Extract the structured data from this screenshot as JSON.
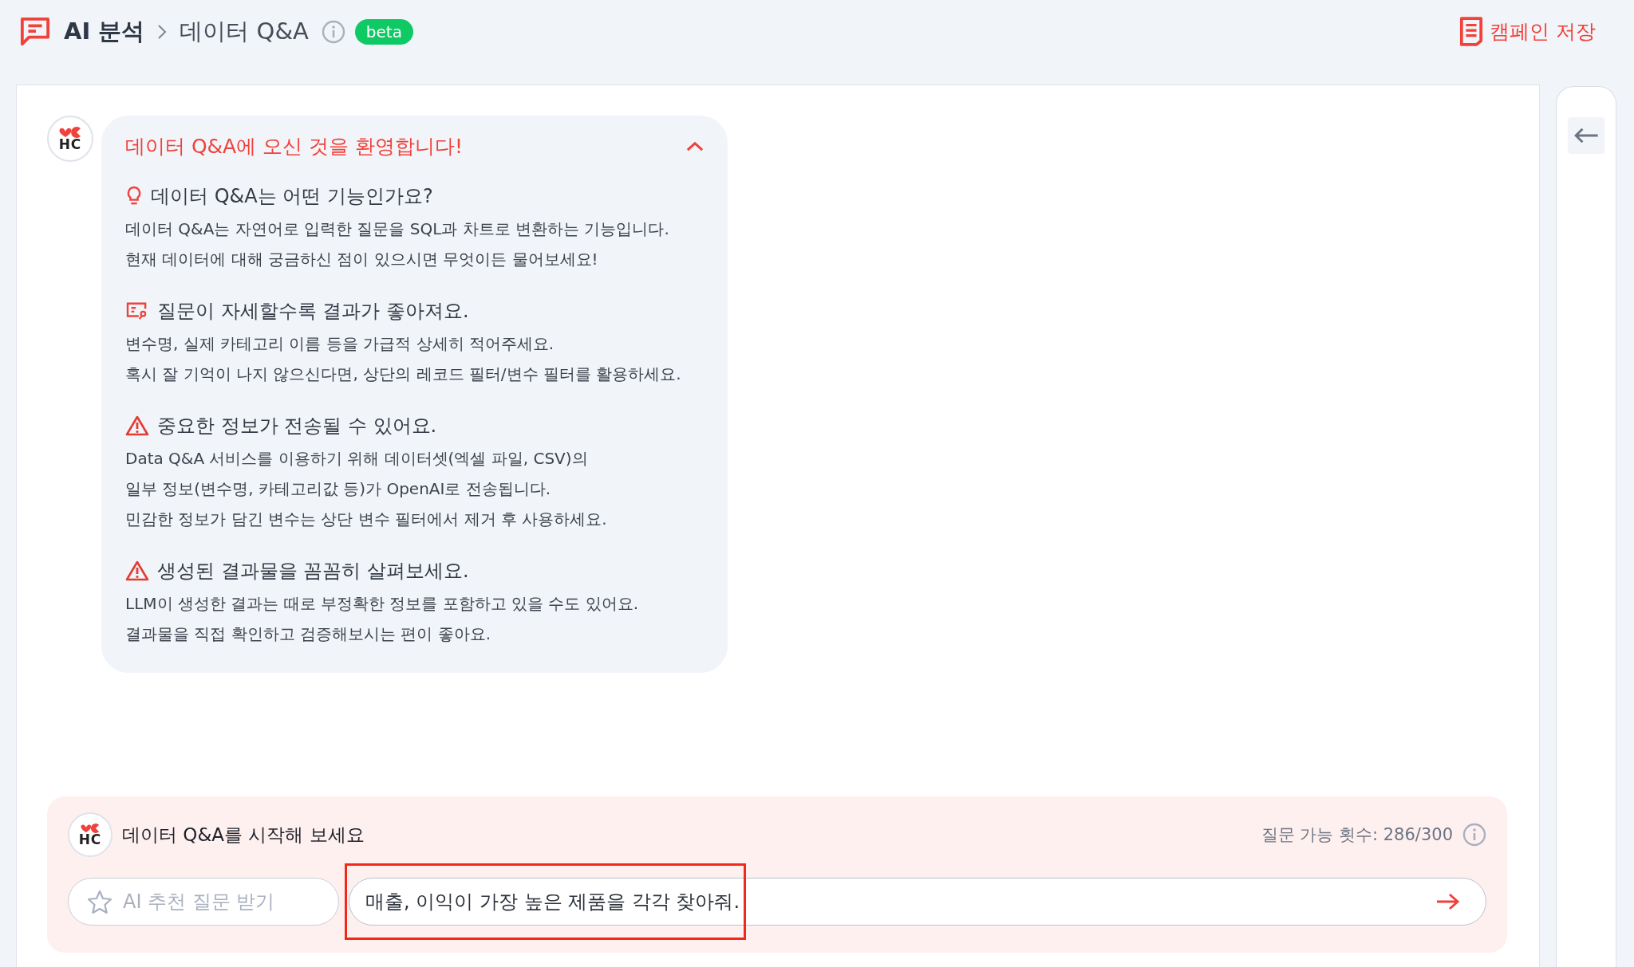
{
  "breadcrumb": [
    {
      "label": "AI 분석"
    },
    {
      "label": "데이터 Q&A"
    }
  ],
  "badge": "beta",
  "save_button": "캠페인 저장",
  "welcome": {
    "avatar": "HC",
    "title": "데이터 Q&A에 오신 것을 환영합니다!",
    "expanded": true,
    "sections": [
      {
        "kind": "bulb",
        "heading": "데이터 Q&A는 어떤 기능인가요?",
        "lines": [
          "데이터 Q&A는 자연어로 입력한 질문을 SQL과 차트로 변환하는 기능입니다.",
          "현재 데이터에 대해 궁금하신 점이 있으시면 무엇이든 물어보세요!"
        ]
      },
      {
        "kind": "filter",
        "heading": "질문이 자세할수록 결과가 좋아져요.",
        "lines": [
          "변수명, 실제 카테고리 이름 등을 가급적 상세히 적어주세요.",
          "혹시 잘 기억이 나지 않으신다면, 상단의 레코드 필터/변수 필터를 활용하세요."
        ]
      },
      {
        "kind": "warning",
        "heading": "중요한 정보가 전송될 수 있어요.",
        "lines": [
          "Data Q&A 서비스를 이용하기 위해 데이터셋(엑셀 파일, CSV)의",
          "일부 정보(변수명, 카테고리값 등)가 OpenAI로 전송됩니다.",
          "민감한 정보가 담긴 변수는 상단 변수 필터에서 제거 후 사용하세요."
        ]
      },
      {
        "kind": "warning",
        "heading": "생성된 결과물을 꼼꼼히 살펴보세요.",
        "lines": [
          "LLM이 생성한 결과는 때로 부정확한 정보를 포함하고 있을 수도 있어요.",
          "결과물을 직접 확인하고 검증해보시는 편이 좋아요."
        ]
      }
    ]
  },
  "composer": {
    "avatar": "HC",
    "title": "데이터 Q&A를 시작해 보세요",
    "quota": "질문 가능 횟수: 286/300",
    "recommend_button": "AI 추천 질문 받기",
    "input_value": "매출, 이익이 가장 높은 제품을 각각 찾아줘.",
    "highlighted": true
  }
}
